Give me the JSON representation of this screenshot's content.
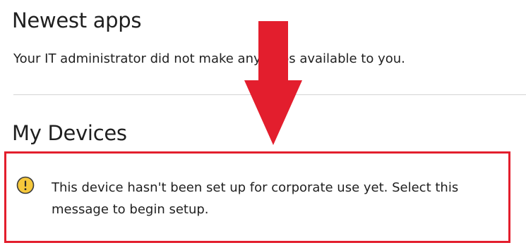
{
  "newest_apps": {
    "title": "Newest apps",
    "empty_message": "Your IT administrator did not make any apps available to you."
  },
  "my_devices": {
    "title": "My Devices",
    "setup_message": "This device hasn't been set up for corporate use yet. Select this message to begin setup.",
    "icon": "warning-icon"
  },
  "colors": {
    "annotation_red": "#e31e2d",
    "warning_yellow": "#f6c83b",
    "warning_outline": "#3a3a3a",
    "divider": "#d4d4d4"
  }
}
